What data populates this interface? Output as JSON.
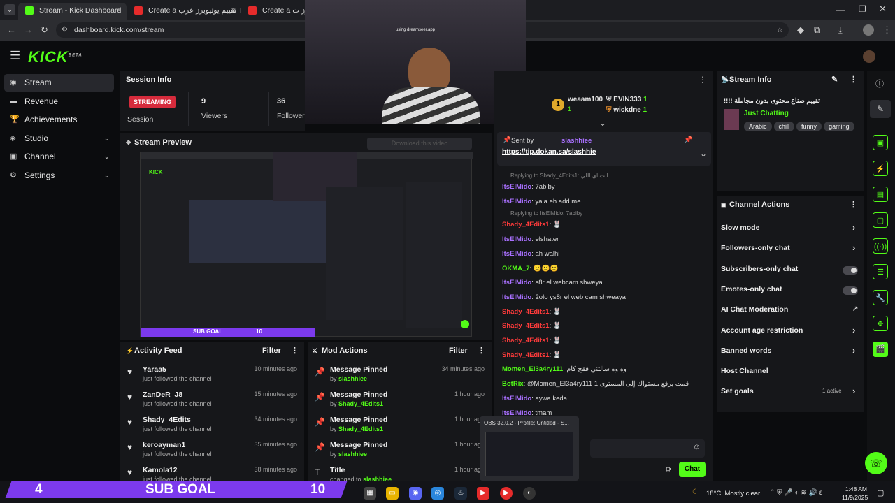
{
  "browser": {
    "tabs": [
      {
        "label": "Stream - Kick Dashboard",
        "active": true,
        "color": "#53fc18"
      },
      {
        "label": "Create a تقييم يوتيوبرز عرب Tier",
        "active": false,
        "color": "#e62b2b"
      },
      {
        "label": "Create a تقييم كريتورز ت",
        "active": false,
        "color": "#e62b2b"
      }
    ],
    "url": "dashboard.kick.com/stream"
  },
  "app": {
    "logo": "KICK",
    "logo_beta": "BETA",
    "sidebar": [
      {
        "label": "Stream",
        "icon": "stream-icon",
        "selected": true
      },
      {
        "label": "Revenue",
        "icon": "revenue-icon"
      },
      {
        "label": "Achievements",
        "icon": "trophy-icon"
      },
      {
        "label": "Studio",
        "icon": "studio-icon",
        "chevron": true
      },
      {
        "label": "Channel",
        "icon": "channel-icon",
        "chevron": true
      },
      {
        "label": "Settings",
        "icon": "gear-icon",
        "chevron": true
      }
    ]
  },
  "session": {
    "title": "Session Info",
    "status": "STREAMING",
    "status_label": "Session",
    "viewers": "9",
    "viewers_label": "Viewers",
    "followers": "36",
    "followers_label": "Followers"
  },
  "preview": {
    "title": "Stream Preview",
    "download_label": "Download this video",
    "webcam_overlay": "using dreamseer.app",
    "goal_label": "SUB GOAL",
    "goal_count": "10"
  },
  "activity": {
    "title": "Activity Feed",
    "filter": "Filter",
    "items": [
      {
        "name": "Yaraa5",
        "sub": "just followed the channel",
        "time": "10 minutes ago"
      },
      {
        "name": "ZanDeR_J8",
        "sub": "just followed the channel",
        "time": "15 minutes ago"
      },
      {
        "name": "Shady_4Edits",
        "sub": "just followed the channel",
        "time": "34 minutes ago"
      },
      {
        "name": "keroayman1",
        "sub": "just followed the channel",
        "time": "35 minutes ago"
      },
      {
        "name": "Kamola12",
        "sub": "just followed the channel",
        "time": "38 minutes ago"
      }
    ]
  },
  "mod": {
    "title": "Mod Actions",
    "filter": "Filter",
    "items": [
      {
        "name": "Message Pinned",
        "by": "by ",
        "user": "slashhiee",
        "time": "34 minutes ago"
      },
      {
        "name": "Message Pinned",
        "by": "by ",
        "user": "Shady_4Edits1",
        "time": "1 hour ago"
      },
      {
        "name": "Message Pinned",
        "by": "by ",
        "user": "Shady_4Edits1",
        "time": "1 hour ago"
      },
      {
        "name": "Message Pinned",
        "by": "by ",
        "user": "slashhiee",
        "time": "1 hour ago"
      },
      {
        "name": "Title",
        "by": "changed to ",
        "user": "slashhiee",
        "time": "1 hour ago"
      }
    ]
  },
  "chat": {
    "top_users": [
      {
        "name": "weaam100",
        "count": "1"
      },
      {
        "name": "EVIN333",
        "count": "1"
      },
      {
        "name": "wickdne",
        "count": "1"
      }
    ],
    "pinned": {
      "sent_by": "Sent by",
      "user": "slashhiee",
      "link": "https://tip.dokan.sa/slashhie"
    },
    "lines": [
      {
        "kind": "reply",
        "text": "Replying to Shady_4Edits1: انت اي اللي"
      },
      {
        "kind": "msg",
        "user": "ItsElMido",
        "color": "p",
        "text": "7abiby"
      },
      {
        "kind": "msg",
        "user": "ItsElMido",
        "color": "p",
        "text": "yala eh add me"
      },
      {
        "kind": "reply",
        "text": "Replying to ItsElMido: 7abiby"
      },
      {
        "kind": "msg",
        "user": "Shady_4Edits1",
        "color": "r",
        "text": "🐰"
      },
      {
        "kind": "msg",
        "user": "ItsElMido",
        "color": "p",
        "text": "elshater"
      },
      {
        "kind": "msg",
        "user": "ItsElMido",
        "color": "p",
        "text": "ah walhi"
      },
      {
        "kind": "msg",
        "user": "OKMA_7",
        "color": "g",
        "text": "🙂🙂🙂"
      },
      {
        "kind": "msg",
        "user": "ItsElMido",
        "color": "p",
        "text": "s8r el webcam shweya"
      },
      {
        "kind": "msg",
        "user": "ItsElMido",
        "color": "p",
        "text": "2olo ys8r el web cam shweaya"
      },
      {
        "kind": "msg",
        "user": "Shady_4Edits1",
        "color": "r",
        "text": "🐰"
      },
      {
        "kind": "msg",
        "user": "Shady_4Edits1",
        "color": "r",
        "text": "🐰"
      },
      {
        "kind": "msg",
        "user": "Shady_4Edits1",
        "color": "r",
        "text": "🐰"
      },
      {
        "kind": "msg",
        "user": "Shady_4Edits1",
        "color": "r",
        "text": "🐰"
      },
      {
        "kind": "msg",
        "user": "Momen_El3a4ry111",
        "color": "g",
        "text": "وه وه سالتني فقج كام"
      },
      {
        "kind": "msg",
        "user": "BotRix",
        "color": "g",
        "text": "@Momen_El3a4ry111 قمت برفع مستواك إلى المستوى 1"
      },
      {
        "kind": "msg",
        "user": "ItsElMido",
        "color": "p",
        "text": "aywa keda"
      },
      {
        "kind": "msg",
        "user": "ItsElMido",
        "color": "p",
        "text": "tmam"
      }
    ],
    "send": "Chat",
    "obs_popup": "OBS 32.0.2 - Profile: Untitled - S..."
  },
  "streaminfo": {
    "title": "Stream Info",
    "stream_title": "تقييم صناع محتوى بدون مجاملة !!!!",
    "category": "Just Chatting",
    "tags": [
      "Arabic",
      "chill",
      "funny",
      "gaming"
    ]
  },
  "actions": {
    "title": "Channel Actions",
    "items": [
      {
        "label": "Slow mode",
        "ctl": "arrow"
      },
      {
        "label": "Followers-only chat",
        "ctl": "arrow"
      },
      {
        "label": "Subscribers-only chat",
        "ctl": "toggle"
      },
      {
        "label": "Emotes-only chat",
        "ctl": "toggle"
      },
      {
        "label": "AI Chat Moderation",
        "ctl": "ext"
      },
      {
        "label": "Account age restriction",
        "ctl": "arrow"
      },
      {
        "label": "Banned words",
        "ctl": "arrow"
      },
      {
        "label": "Host Channel",
        "ctl": "none"
      },
      {
        "label": "Set goals",
        "ctl": "arrow",
        "extra": "1 active"
      }
    ]
  },
  "taskbar": {
    "goal_num": "4",
    "goal_label": "SUB GOAL",
    "goal_target": "10",
    "weather": "18°C  Mostly clear",
    "time": "1:48 AM",
    "date": "11/9/2025"
  },
  "colors": {
    "brand": "#53fc18",
    "live": "#d62b3c",
    "purple": "#7c3aed"
  }
}
